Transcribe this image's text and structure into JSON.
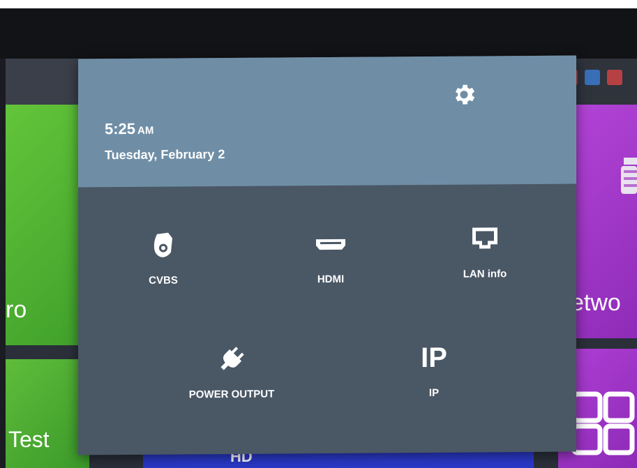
{
  "background": {
    "tile_labels": {
      "left_top": "ro",
      "left_bottom": "Test",
      "right_top": "etwo",
      "bottom_center": "HD"
    }
  },
  "quick_settings": {
    "time": "5:25",
    "ampm": "AM",
    "date": "Tuesday, February 2",
    "settings_icon": "gear-icon",
    "tiles": [
      {
        "label": "CVBS",
        "icon": "dome-camera-icon"
      },
      {
        "label": "HDMI",
        "icon": "hdmi-icon"
      },
      {
        "label": "LAN info",
        "icon": "ethernet-port-icon"
      },
      {
        "label": "POWER OUTPUT",
        "icon": "power-plug-icon"
      },
      {
        "label": "IP",
        "icon": "ip-icon",
        "glyph": "IP"
      }
    ]
  },
  "colors": {
    "panel_header": "#6f8ea6",
    "panel_body": "#4a5765",
    "tile_green": "#4fb232",
    "tile_purple": "#a43acb",
    "tile_blue": "#2a39c8"
  }
}
